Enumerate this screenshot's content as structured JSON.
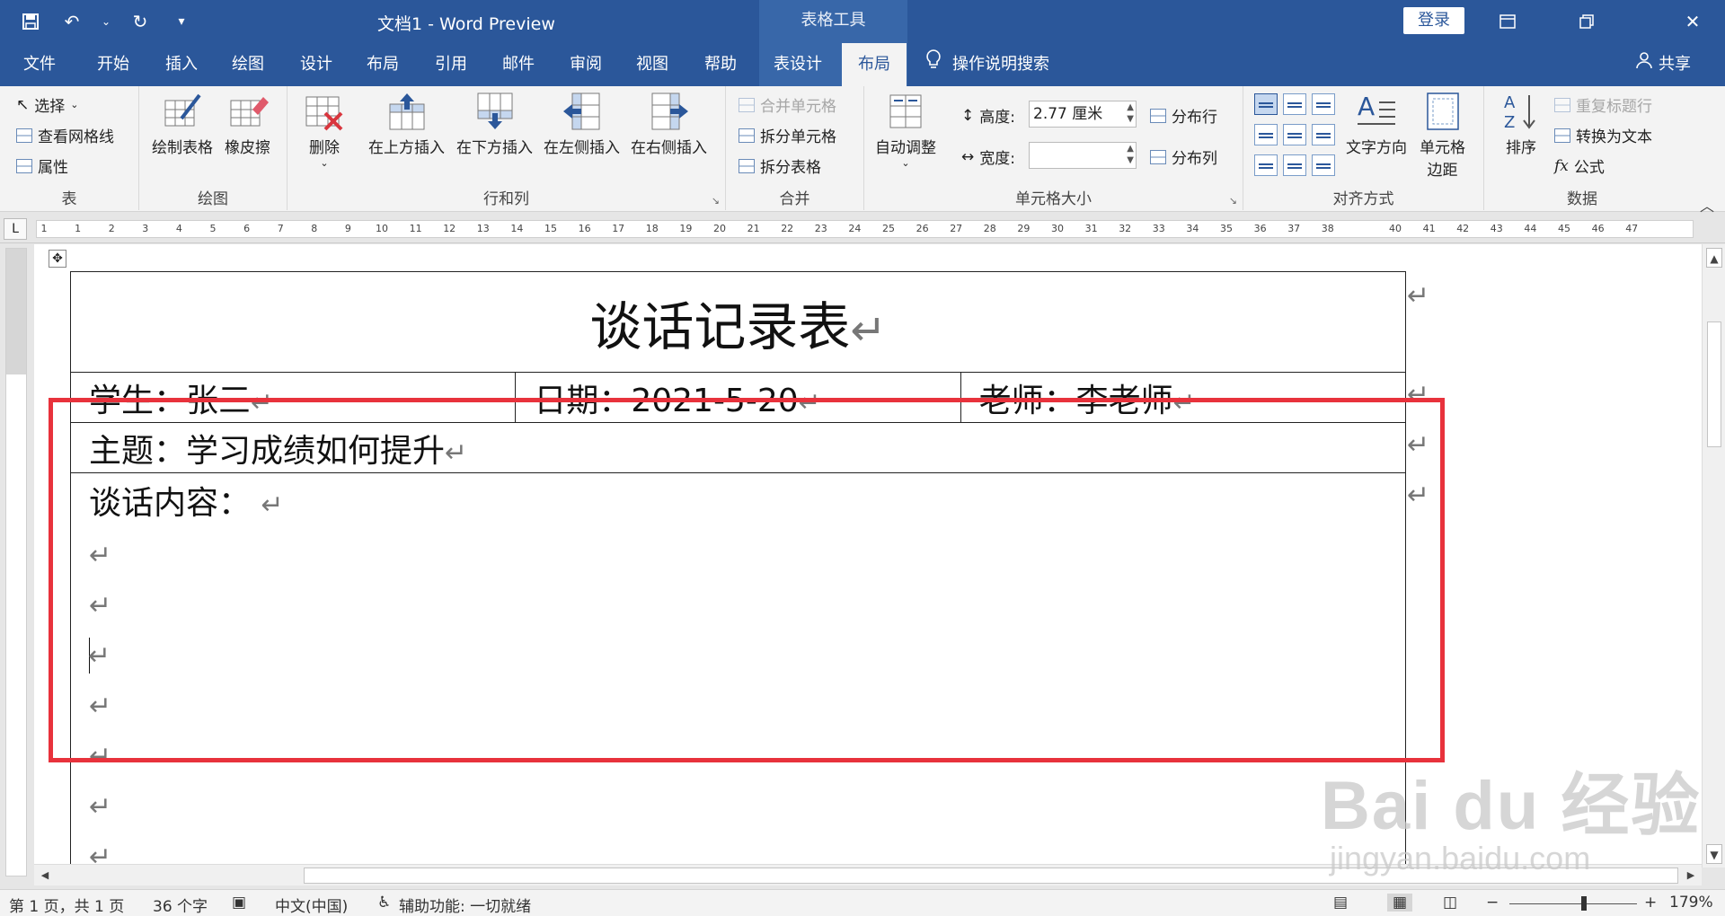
{
  "titlebar": {
    "doc_title": "文档1  -  Word Preview",
    "context_tools": "表格工具",
    "login": "登录",
    "qat_icons": [
      "save-icon",
      "undo-icon",
      "redo-icon",
      "customize-icon"
    ]
  },
  "tabs": [
    "文件",
    "开始",
    "插入",
    "绘图",
    "设计",
    "布局",
    "引用",
    "邮件",
    "审阅",
    "视图",
    "帮助",
    "表设计",
    "布局"
  ],
  "active_tab": "布局",
  "tell_me": "操作说明搜索",
  "share": "共享",
  "ribbon": {
    "table": {
      "label": "表",
      "select": "选择",
      "gridlines": "查看网格线",
      "properties": "属性"
    },
    "draw": {
      "label": "绘图",
      "draw_table": "绘制表格",
      "eraser": "橡皮擦"
    },
    "rows_cols": {
      "label": "行和列",
      "delete": "删除",
      "insert_above": "在上方插入",
      "insert_below": "在下方插入",
      "insert_left": "在左侧插入",
      "insert_right": "在右侧插入"
    },
    "merge": {
      "label": "合并",
      "merge_cells": "合并单元格",
      "split_cells": "拆分单元格",
      "split_table": "拆分表格"
    },
    "cell_size": {
      "label": "单元格大小",
      "autofit": "自动调整",
      "height_label": "高度:",
      "height_value": "2.77 厘米",
      "width_label": "宽度:",
      "width_value": "",
      "dist_rows": "分布行",
      "dist_cols": "分布列"
    },
    "alignment": {
      "label": "对齐方式",
      "text_direction": "文字方向",
      "cell_margins_1": "单元格",
      "cell_margins_2": "边距"
    },
    "data": {
      "label": "数据",
      "sort": "排序",
      "repeat_header": "重复标题行",
      "convert_text": "转换为文本",
      "formula": "公式"
    }
  },
  "ruler_numbers": [
    "1",
    "1",
    "2",
    "3",
    "4",
    "5",
    "6",
    "7",
    "8",
    "9",
    "10",
    "11",
    "12",
    "13",
    "14",
    "15",
    "16",
    "17",
    "18",
    "19",
    "20",
    "21",
    "22",
    "23",
    "24",
    "25",
    "26",
    "27",
    "28",
    "29",
    "30",
    "31",
    "32",
    "33",
    "34",
    "35",
    "36",
    "37",
    "38",
    "40",
    "41",
    "42",
    "43",
    "44",
    "45",
    "46",
    "47"
  ],
  "ruler_corner": "L",
  "document": {
    "title": "谈话记录表",
    "student": "学生：张三",
    "date": "日期：2021-5-20",
    "teacher": "老师：李老师",
    "topic": "主题：学习成绩如何提升",
    "content_label": "谈话内容：",
    "para_mark": "↵"
  },
  "status": {
    "page": "第 1 页，共 1 页",
    "words": "36 个字",
    "language": "中文(中国)",
    "accessibility": "辅助功能: 一切就绪",
    "zoom": "179%"
  },
  "watermark": {
    "main": "Bai du 经验",
    "sub": "jingyan.baidu.com"
  }
}
